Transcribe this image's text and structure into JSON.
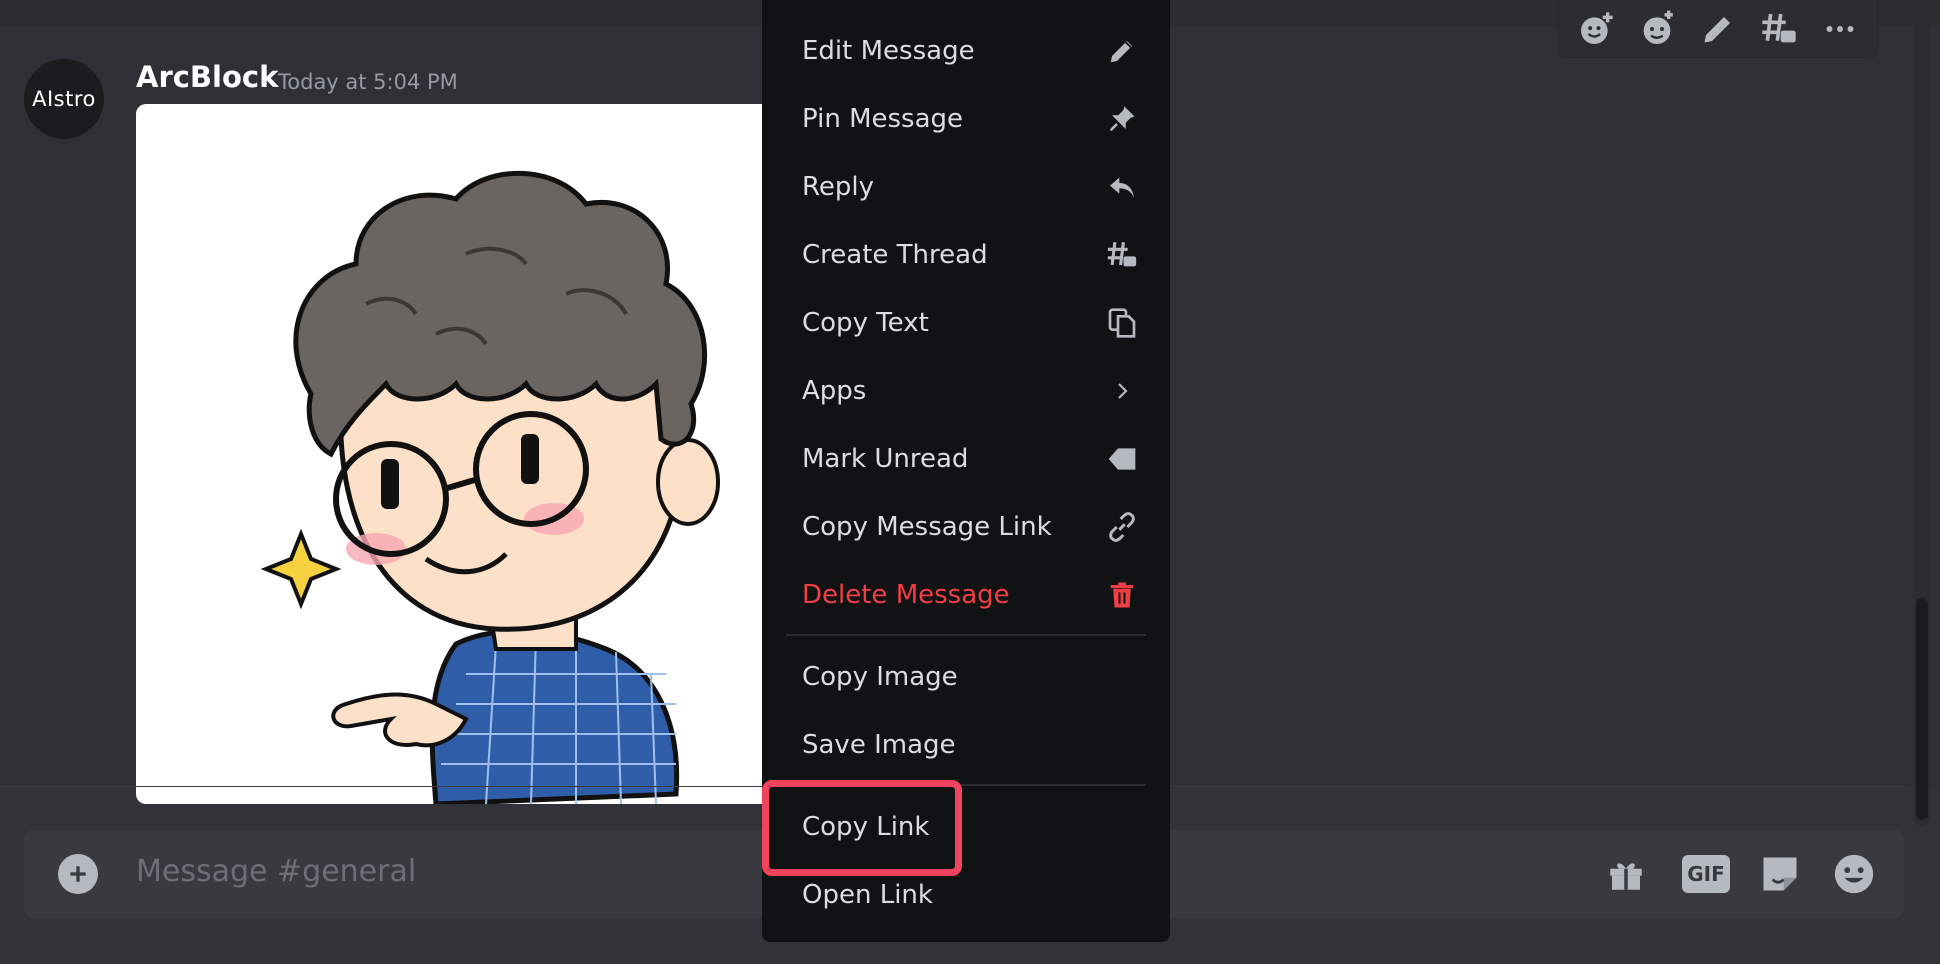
{
  "message": {
    "avatar_text": "AIstro",
    "author": "ArcBlock",
    "timestamp": "Today at 5:04 PM"
  },
  "hover_toolbar": {
    "icons": [
      "add-reaction-icon",
      "super-reaction-icon",
      "edit-icon",
      "create-thread-icon",
      "more-icon"
    ]
  },
  "context_menu": {
    "items": [
      {
        "label": "Edit Message",
        "icon": "pencil-icon"
      },
      {
        "label": "Pin Message",
        "icon": "pin-icon"
      },
      {
        "label": "Reply",
        "icon": "reply-icon"
      },
      {
        "label": "Create Thread",
        "icon": "thread-icon"
      },
      {
        "label": "Copy Text",
        "icon": "copy-icon"
      },
      {
        "label": "Apps",
        "icon": "chevron-right-icon"
      },
      {
        "label": "Mark Unread",
        "icon": "mark-unread-icon"
      },
      {
        "label": "Copy Message Link",
        "icon": "link-icon"
      },
      {
        "label": "Delete Message",
        "icon": "trash-icon",
        "danger": true
      },
      {
        "label": "Copy Image"
      },
      {
        "label": "Save Image"
      },
      {
        "label": "Copy Link",
        "highlighted": true
      },
      {
        "label": "Open Link"
      }
    ]
  },
  "composer": {
    "placeholder": "Message #general",
    "gif_label": "GIF",
    "tool_icons": [
      "gift-icon",
      "gif-icon",
      "sticker-icon",
      "emoji-icon"
    ]
  },
  "colors": {
    "background": "#313338",
    "menu_background": "#111214",
    "danger": "#f23f43",
    "highlight": "#f0445e"
  }
}
